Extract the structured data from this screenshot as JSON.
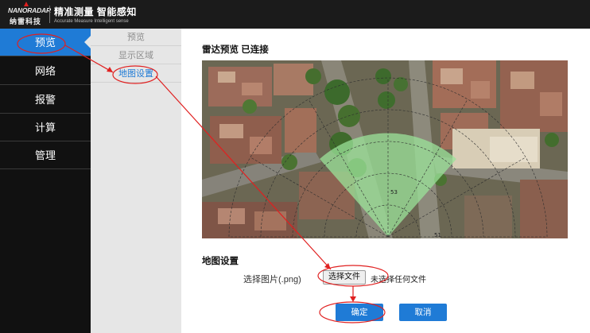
{
  "header": {
    "logo_top": "NANORADAR",
    "logo_bottom": "纳雷科技",
    "slogan_main": "精准测量 智能感知",
    "slogan_sub": "Accurate Measure   Intelligent sense"
  },
  "nav": {
    "items": [
      {
        "label": "预览",
        "active": true
      },
      {
        "label": "网络"
      },
      {
        "label": "报警"
      },
      {
        "label": "计算"
      },
      {
        "label": "管理"
      }
    ]
  },
  "subnav": {
    "items": [
      {
        "label": "预览"
      },
      {
        "label": "显示区域"
      },
      {
        "label": "地图设置",
        "active": true
      }
    ]
  },
  "main": {
    "preview_title": "雷达预览 已连接",
    "map_labels": {
      "ring_inner": "53",
      "ring_outer": "51"
    },
    "map_settings_title": "地图设置",
    "file": {
      "label": "选择图片(.png)",
      "button": "选择文件",
      "status": "未选择任何文件"
    },
    "confirm": "确定",
    "cancel": "取消"
  },
  "colors": {
    "accent": "#1f7bd6",
    "annotation": "#e02020",
    "radar_sector": "#9be39a"
  }
}
